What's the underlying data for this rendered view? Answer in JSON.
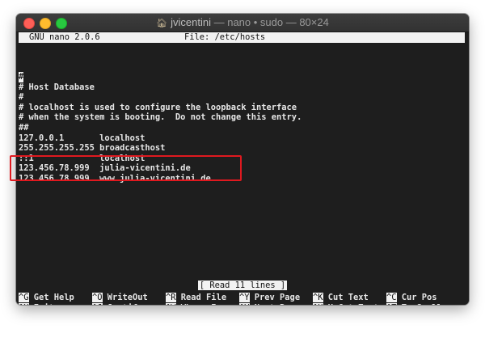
{
  "window": {
    "title_user": "jvicentini",
    "title_rest": " — nano • sudo — 80×24",
    "traffic_lights": [
      "close",
      "minimize",
      "maximize"
    ]
  },
  "nano": {
    "version_label": "GNU nano 2.0.6",
    "file_label": "File: /etc/hosts",
    "cursor_char": "#",
    "lines": [
      "#",
      "# Host Database",
      "#",
      "# localhost is used to configure the loopback interface",
      "# when the system is booting.  Do not change this entry.",
      "##",
      "127.0.0.1       localhost",
      "255.255.255.255 broadcasthost",
      "::1             localhost",
      "123.456.78.999  julia-vicentini.de",
      "123.456.78.999  www.julia-vicentini.de"
    ],
    "status_message": "[ Read 11 lines ]",
    "shortcuts_row1": [
      {
        "key": "^G",
        "label": "Get Help"
      },
      {
        "key": "^O",
        "label": "WriteOut"
      },
      {
        "key": "^R",
        "label": "Read File"
      },
      {
        "key": "^Y",
        "label": "Prev Page"
      },
      {
        "key": "^K",
        "label": "Cut Text"
      },
      {
        "key": "^C",
        "label": "Cur Pos"
      }
    ],
    "shortcuts_row2": [
      {
        "key": "^X",
        "label": "Exit"
      },
      {
        "key": "^J",
        "label": "Justify"
      },
      {
        "key": "^W",
        "label": "Where Is"
      },
      {
        "key": "^V",
        "label": "Next Page"
      },
      {
        "key": "^U",
        "label": "UnCut Text"
      },
      {
        "key": "^T",
        "label": "To Spell"
      }
    ]
  },
  "colors": {
    "terminal_bg": "#1e1e1e",
    "terminal_fg": "#e6e6e6",
    "inverse_bg": "#f2f2f2",
    "highlight_box": "#e0191f"
  }
}
